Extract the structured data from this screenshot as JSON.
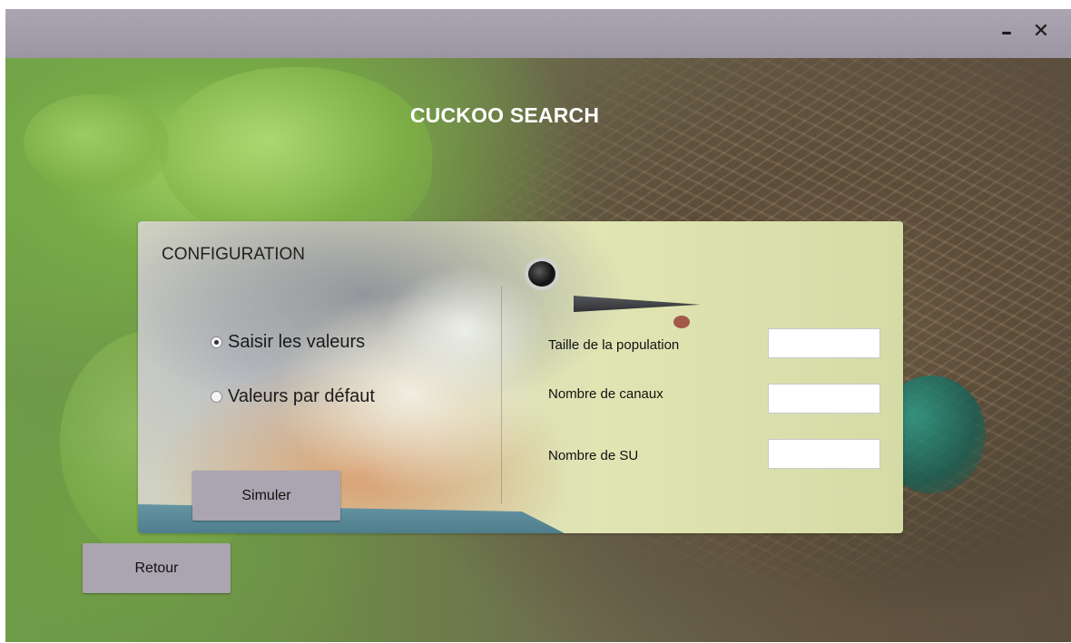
{
  "window": {
    "minimize_glyph": "–",
    "close_glyph": "✕"
  },
  "app": {
    "title": "CUCKOO SEARCH"
  },
  "config": {
    "title": "CONFIGURATION",
    "mode_options": [
      {
        "label": "Saisir les valeurs",
        "checked": true
      },
      {
        "label": "Valeurs par défaut",
        "checked": false
      }
    ],
    "fields": [
      {
        "label": "Taille de la population",
        "value": ""
      },
      {
        "label": "Nombre de canaux",
        "value": ""
      },
      {
        "label": "Nombre de SU",
        "value": ""
      }
    ],
    "simulate_label": "Simuler"
  },
  "footer": {
    "back_label": "Retour"
  },
  "icons": {
    "minimize": "minimize-icon",
    "close": "close-icon",
    "radio_checked": "radio-checked-icon",
    "radio_unchecked": "radio-unchecked-icon"
  },
  "colors": {
    "titlebar": "#a39dab",
    "button": "#aaa5b1",
    "title_text": "#ffffff"
  }
}
